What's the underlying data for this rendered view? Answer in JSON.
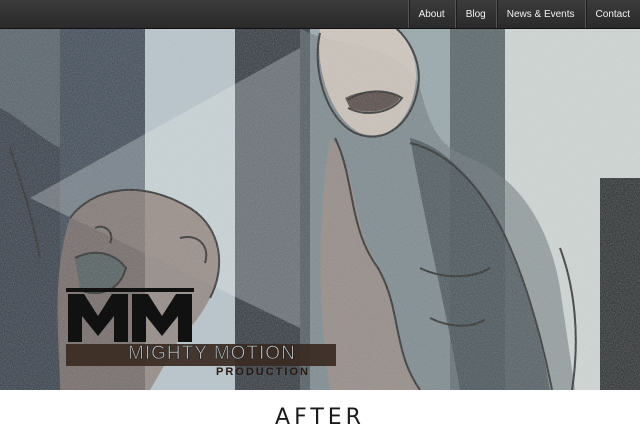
{
  "nav": {
    "items": [
      {
        "label": "About"
      },
      {
        "label": "Blog"
      },
      {
        "label": "News & Events"
      },
      {
        "label": "Contact"
      }
    ]
  },
  "hero": {
    "logo": {
      "monogram": "MM",
      "name": "MIGHTY MOTION",
      "sub": "PRODUCTION"
    }
  },
  "caption": "AFTER",
  "colors": {
    "topbar": "#333333",
    "stripe_dark": "#28323c",
    "stripe_light": "#c6cfd0",
    "logo_band": "#3a2a22"
  }
}
